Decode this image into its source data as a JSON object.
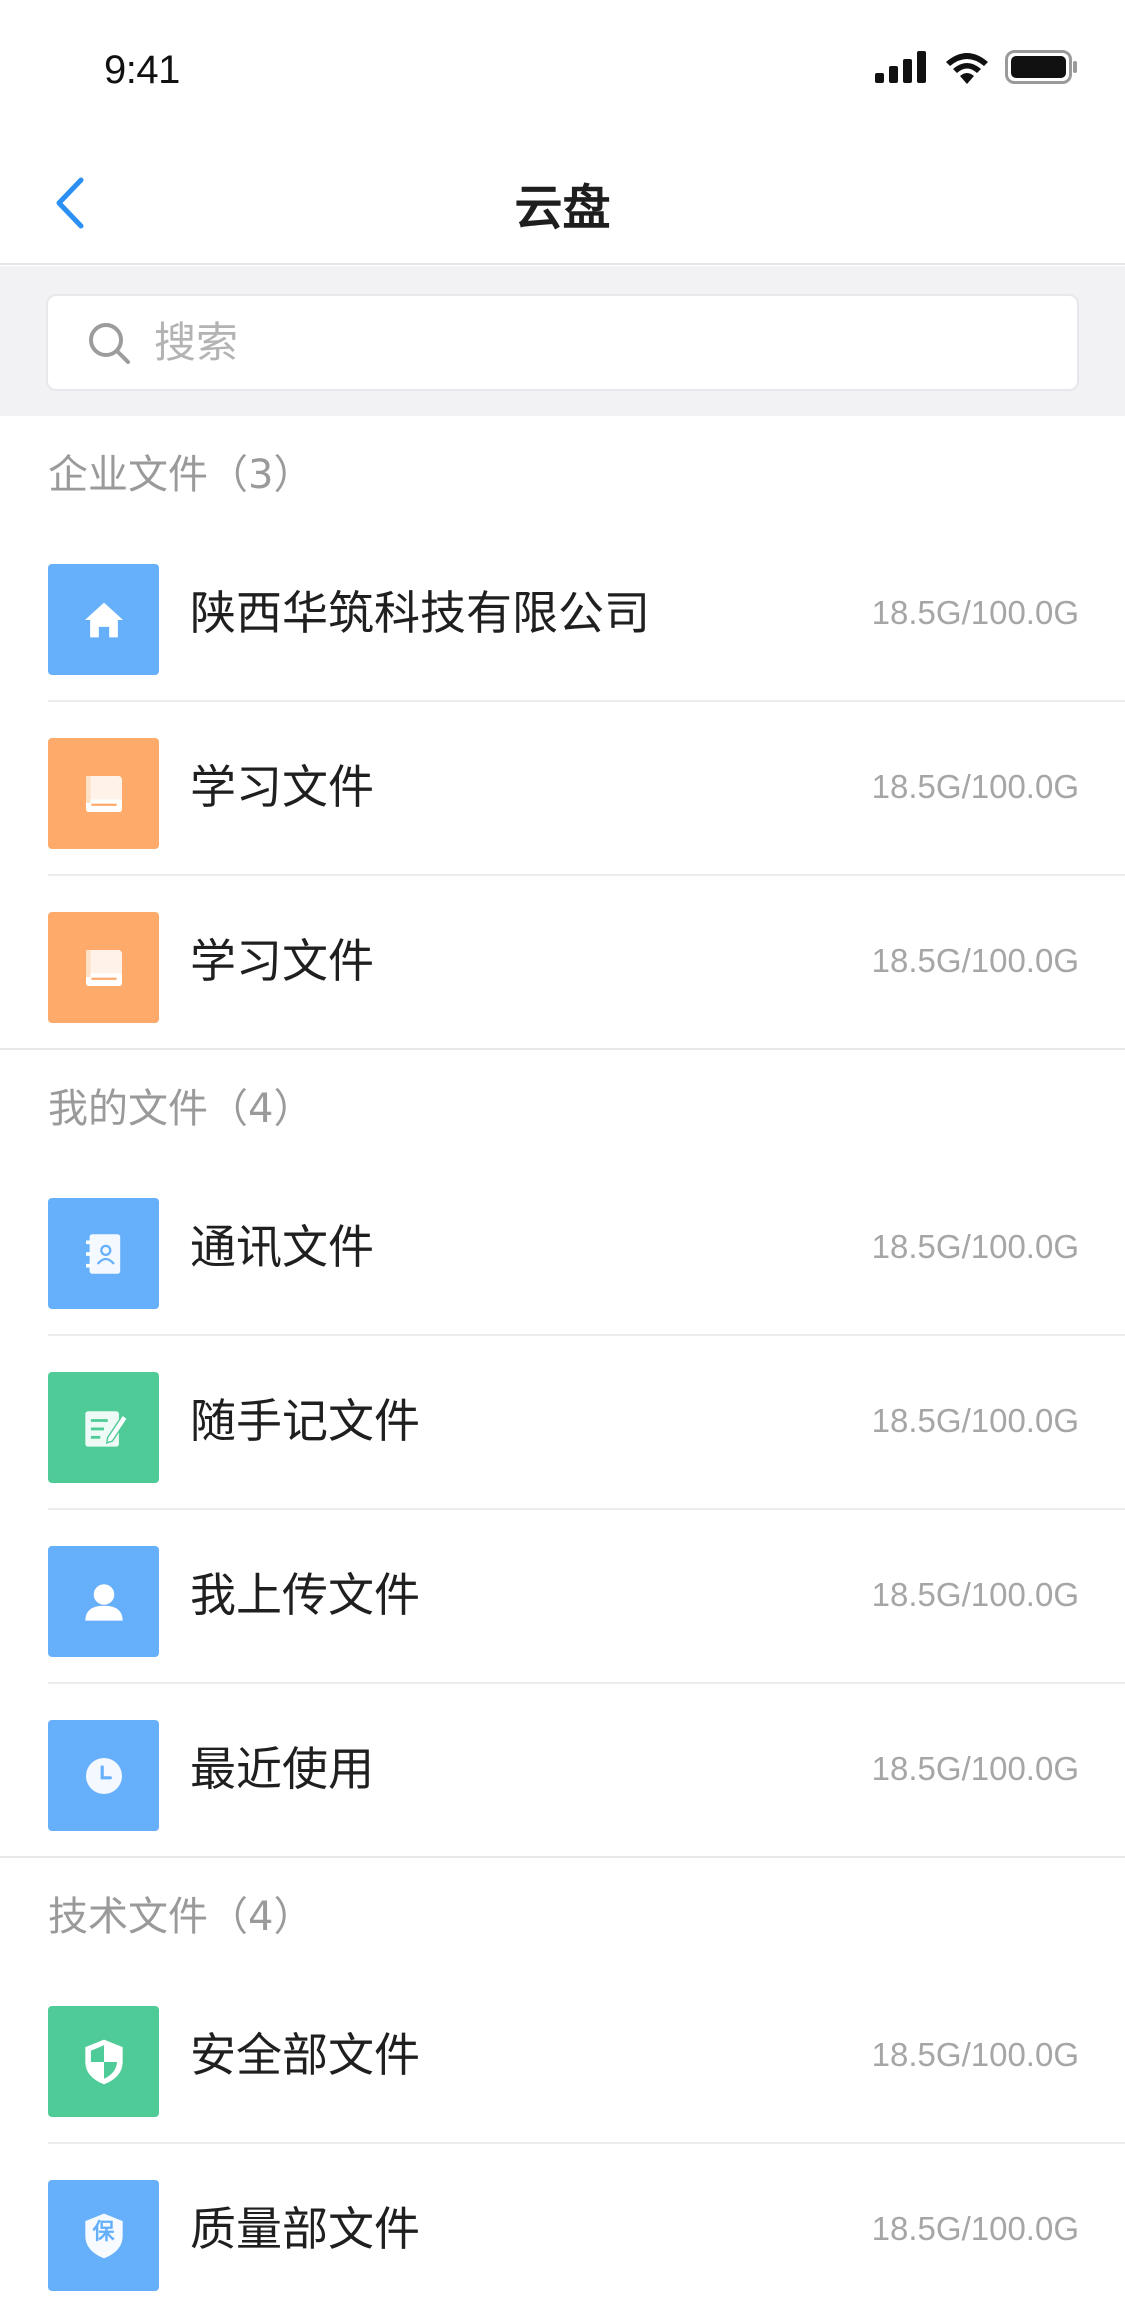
{
  "status": {
    "time": "9:41"
  },
  "nav": {
    "title": "云盘"
  },
  "search": {
    "placeholder": "搜索"
  },
  "colors": {
    "blue": "#66b0fb",
    "orange": "#fdaa6a",
    "green": "#4ecb96",
    "accent": "#2b8ff4"
  },
  "sections": [
    {
      "title": "企业文件（3）",
      "items": [
        {
          "label": "陕西华筑科技有限公司",
          "size": "18.5G/100.0G",
          "icon": "home-icon",
          "color": "blue"
        },
        {
          "label": "学习文件",
          "size": "18.5G/100.0G",
          "icon": "book-icon",
          "color": "orange"
        },
        {
          "label": "学习文件",
          "size": "18.5G/100.0G",
          "icon": "book-icon",
          "color": "orange"
        }
      ]
    },
    {
      "title": "我的文件（4）",
      "items": [
        {
          "label": "通讯文件",
          "size": "18.5G/100.0G",
          "icon": "contacts-icon",
          "color": "blue"
        },
        {
          "label": "随手记文件",
          "size": "18.5G/100.0G",
          "icon": "note-edit-icon",
          "color": "green"
        },
        {
          "label": "我上传文件",
          "size": "18.5G/100.0G",
          "icon": "user-icon",
          "color": "blue"
        },
        {
          "label": "最近使用",
          "size": "18.5G/100.0G",
          "icon": "clock-icon",
          "color": "blue"
        }
      ]
    },
    {
      "title": "技术文件（4）",
      "items": [
        {
          "label": "安全部文件",
          "size": "18.5G/100.0G",
          "icon": "shield-icon",
          "color": "green"
        },
        {
          "label": "质量部文件",
          "size": "18.5G/100.0G",
          "icon": "shield-badge-icon",
          "color": "blue",
          "badge_text": "保"
        }
      ]
    }
  ]
}
